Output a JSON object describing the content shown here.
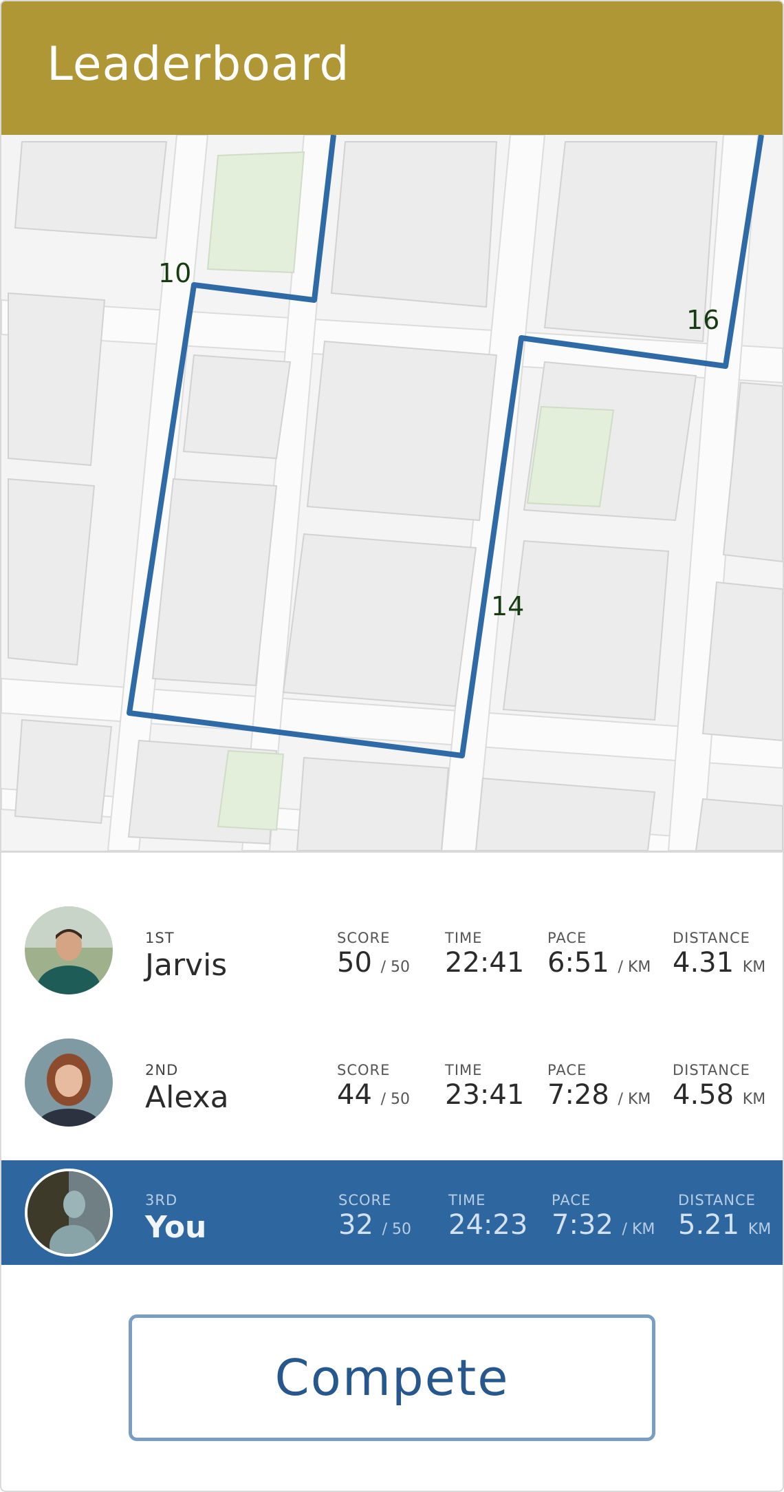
{
  "header": {
    "title": "Leaderboard"
  },
  "map": {
    "route_color": "#2e6aa5",
    "markers": [
      {
        "label": "10"
      },
      {
        "label": "16"
      },
      {
        "label": "14"
      }
    ]
  },
  "columns": {
    "score": "SCORE",
    "time": "TIME",
    "pace": "PACE",
    "distance": "DISTANCE"
  },
  "entries": [
    {
      "rank": "1ST",
      "name": "Jarvis",
      "score": "50",
      "score_max": "/ 50",
      "time": "22:41",
      "pace": "6:51",
      "pace_unit": "/ KM",
      "distance": "4.31",
      "distance_unit": "KM"
    },
    {
      "rank": "2ND",
      "name": "Alexa",
      "score": "44",
      "score_max": "/ 50",
      "time": "23:41",
      "pace": "7:28",
      "pace_unit": "/ KM",
      "distance": "4.58",
      "distance_unit": "KM"
    },
    {
      "rank": "3RD",
      "name": "You",
      "score": "32",
      "score_max": "/ 50",
      "time": "24:23",
      "pace": "7:32",
      "pace_unit": "/ KM",
      "distance": "5.21",
      "distance_unit": "KM"
    }
  ],
  "actions": {
    "compete_label": "Compete"
  },
  "colors": {
    "header": "#b09735",
    "highlight": "#2e679f",
    "accent": "#26578d"
  }
}
